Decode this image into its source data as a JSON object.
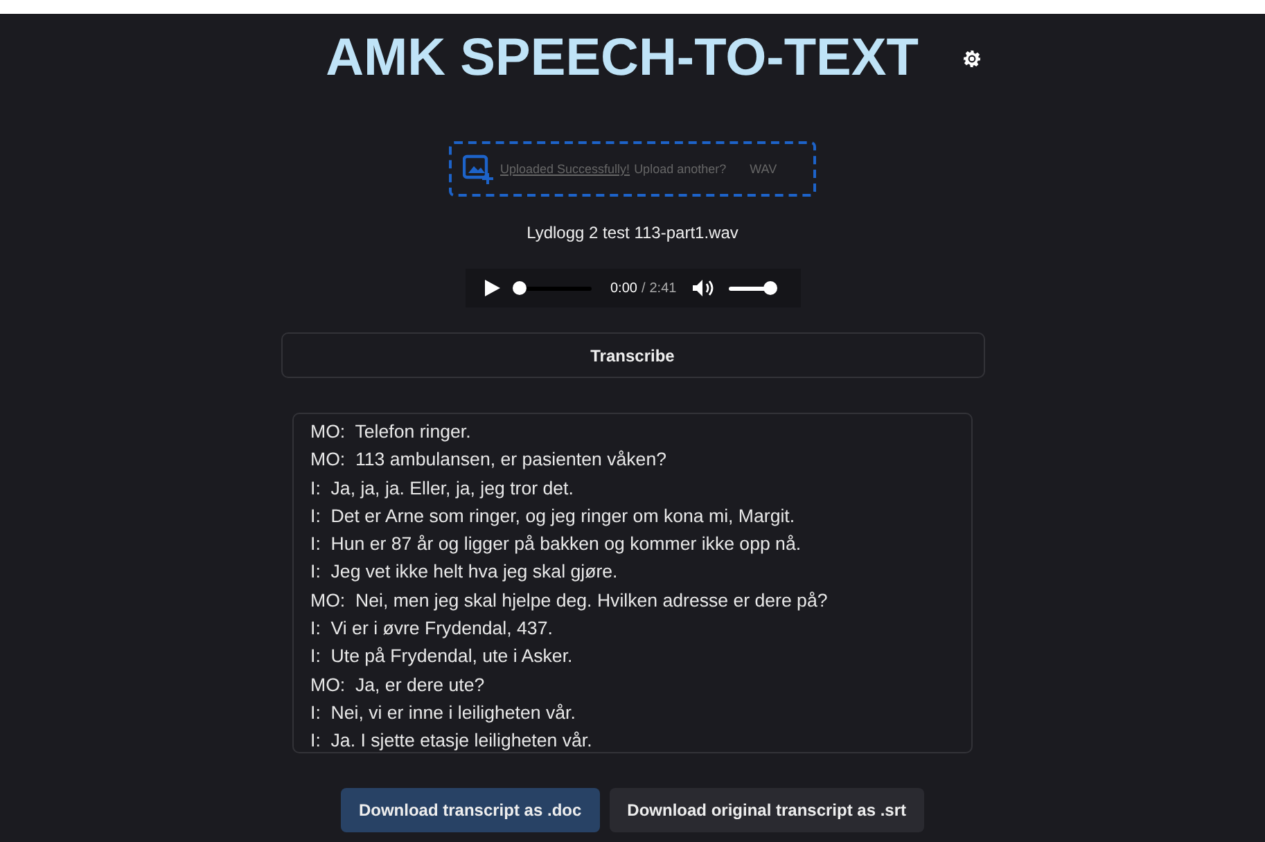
{
  "title": "AMK SPEECH-TO-TEXT",
  "upload": {
    "status": "Uploaded Successfully!",
    "prompt": "Upload another?",
    "format": "WAV"
  },
  "file_name": "Lydlogg 2 test 113-part1.wav",
  "player": {
    "current": "0:00",
    "separator": "/",
    "duration": "2:41",
    "progress": {
      "level": 0
    },
    "volume": {
      "level": 1
    }
  },
  "transcribe_button": "Transcribe",
  "transcript": [
    "MO:  Telefon ringer.",
    "MO:  113 ambulansen, er pasienten våken?",
    "I:  Ja, ja, ja. Eller, ja, jeg tror det.",
    "I:  Det er Arne som ringer, og jeg ringer om kona mi, Margit.",
    "I:  Hun er 87 år og ligger på bakken og kommer ikke opp nå.",
    "I:  Jeg vet ikke helt hva jeg skal gjøre.",
    "MO:  Nei, men jeg skal hjelpe deg. Hvilken adresse er dere på?",
    "I:  Vi er i øvre Frydendal, 437.",
    "I:  Ute på Frydendal, ute i Asker.",
    "MO:  Ja, er dere ute?",
    "I:  Nei, vi er inne i leiligheten vår.",
    "I:  Ja. I sjette etasje leiligheten vår."
  ],
  "downloads": [
    {
      "label": "Download transcript as .doc",
      "primary": true
    },
    {
      "label": "Download original transcript as .srt",
      "primary": false
    }
  ]
}
